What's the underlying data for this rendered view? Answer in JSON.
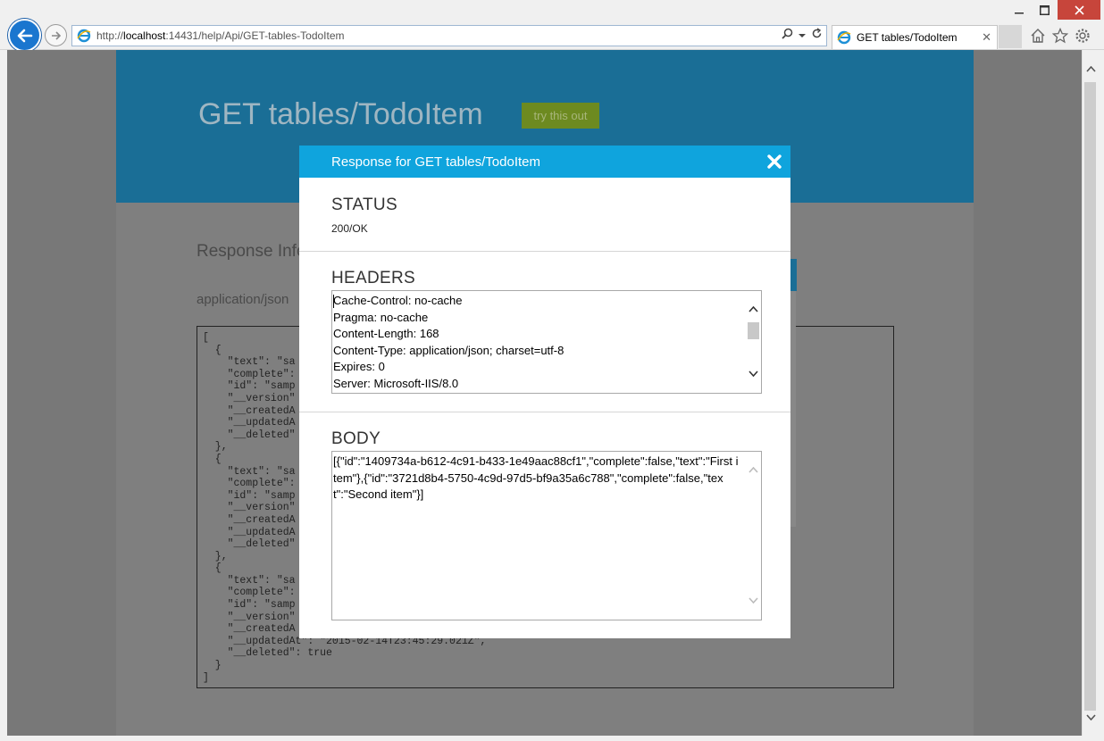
{
  "browser": {
    "url_prefix": "http://",
    "url_host": "localhost",
    "url_rest": ":14431/help/Api/GET-tables-TodoItem",
    "tab_title": "GET tables/TodoItem",
    "icons": [
      "back-icon",
      "forward-icon",
      "ie-icon",
      "search-icon",
      "dropdown-icon",
      "refresh-icon",
      "tab-close-icon",
      "home-icon",
      "favorites-icon",
      "settings-icon",
      "minimize-icon",
      "maximize-icon",
      "close-icon"
    ]
  },
  "page": {
    "title": "GET tables/TodoItem",
    "try_button": "try this out",
    "section_title": "Response Info",
    "content_type": "application/json",
    "sample_json": "[\n  {\n    \"text\": \"sa\n    \"complete\":\n    \"id\": \"samp\n    \"__version\"\n    \"__createdA\n    \"__updatedA\n    \"__deleted\"\n  },\n  {\n    \"text\": \"sa\n    \"complete\":\n    \"id\": \"samp\n    \"__version\"\n    \"__createdA\n    \"__updatedA\n    \"__deleted\"\n  },\n  {\n    \"text\": \"sa\n    \"complete\":\n    \"id\": \"samp\n    \"__version\"\n    \"__createdA\n    \"__updatedAt\": \"2015-02-14T23:45:29.021Z\",\n    \"__deleted\": true\n  }\n]"
  },
  "modal": {
    "title": "Response for GET tables/TodoItem",
    "status_label": "STATUS",
    "status_value": "200/OK",
    "headers_label": "HEADERS",
    "headers": [
      "Cache-Control: no-cache",
      "Pragma: no-cache",
      "Content-Length: 168",
      "Content-Type: application/json; charset=utf-8",
      "Expires: 0",
      "Server: Microsoft-IIS/8.0"
    ],
    "body_label": "BODY",
    "body_value": "[{\"id\":\"1409734a-b612-4c91-b433-1e49aac88cf1\",\"complete\":false,\"text\":\"First item\"},{\"id\":\"3721d8b4-5750-4c9d-97d5-bf9a35a6c788\",\"complete\":false,\"text\":\"Second item\"}]"
  },
  "colors": {
    "modal_header": "#0fa4dd",
    "page_header": "#1a6e96",
    "try_button": "#6d8a20",
    "close_button": "#c7453b"
  }
}
